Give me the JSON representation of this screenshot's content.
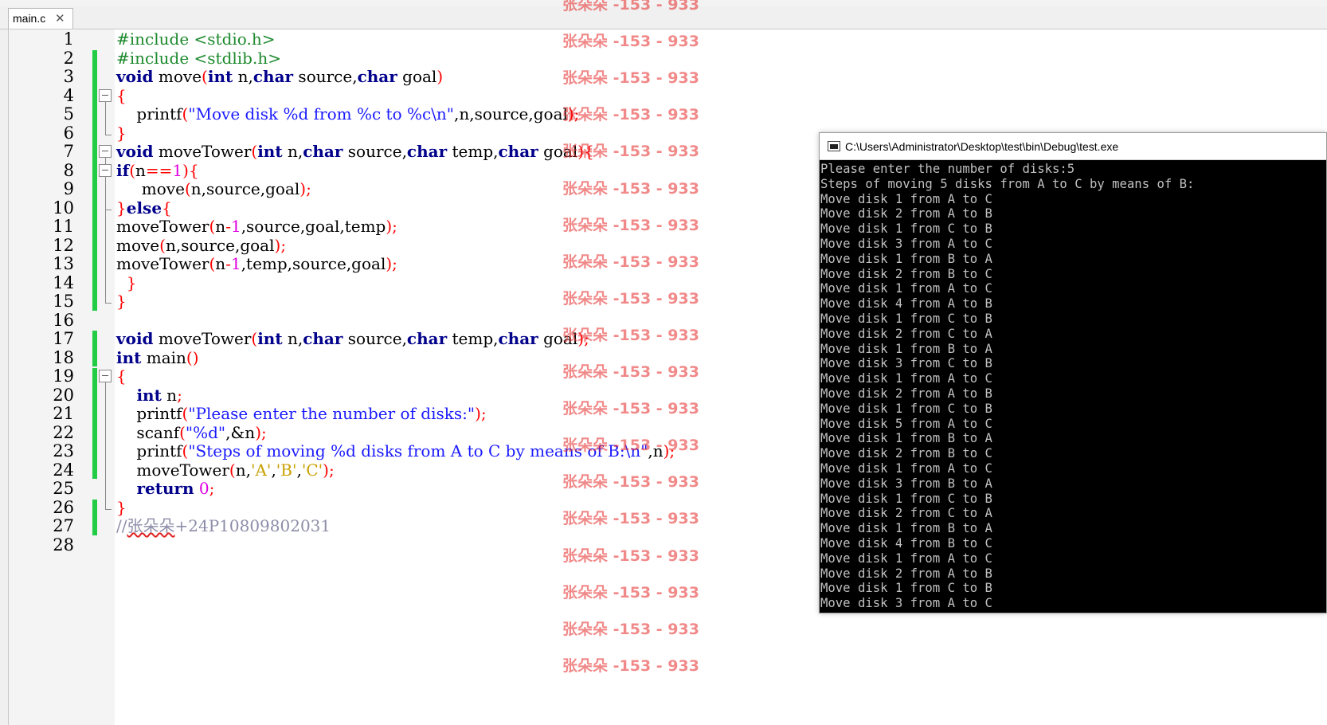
{
  "tab": {
    "label": "main.c",
    "close": "✕"
  },
  "line_numbers": [
    "1",
    "2",
    "3",
    "4",
    "5",
    "6",
    "7",
    "8",
    "9",
    "10",
    "11",
    "12",
    "13",
    "14",
    "15",
    "16",
    "17",
    "18",
    "19",
    "20",
    "21",
    "22",
    "23",
    "24",
    "25",
    "26",
    "27",
    "28"
  ],
  "code": {
    "line1": [
      "#include <stdio.h>"
    ],
    "line2": [
      "#include <stdlib.h>"
    ],
    "line3": [
      "void",
      " move",
      "(",
      "int",
      " n,",
      "char",
      " source,",
      "char",
      " goal",
      ")"
    ],
    "line4": [
      "{"
    ],
    "line5": [
      "    printf",
      "(",
      "\"Move disk %d from %c to %c\\n\"",
      ",n,source,goal",
      ")",
      ";"
    ],
    "line6": [
      "}"
    ],
    "line7": [
      "void",
      " moveTower",
      "(",
      "int",
      " n,",
      "char",
      " source,",
      "char",
      " temp,",
      "char",
      " goal",
      ")",
      "{"
    ],
    "line8": [
      "if",
      "(",
      "n",
      "==",
      "1",
      ")",
      "{"
    ],
    "line9": [
      "     move",
      "(",
      "n,source,goal",
      ")",
      ";"
    ],
    "line10": [
      "}",
      "else",
      "{"
    ],
    "line11": [
      "moveTower",
      "(",
      "n",
      "-",
      "1",
      ",source,goal,temp",
      ")",
      ";"
    ],
    "line12": [
      "move",
      "(",
      "n,source,goal",
      ")",
      ";"
    ],
    "line13": [
      "moveTower",
      "(",
      "n",
      "-",
      "1",
      ",temp,source,goal",
      ")",
      ";"
    ],
    "line14": [
      "  }"
    ],
    "line15": [
      "}"
    ],
    "line16": [
      ""
    ],
    "line17": [
      "void",
      " moveTower",
      "(",
      "int",
      " n,",
      "char",
      " source,",
      "char",
      " temp,",
      "char",
      " goal",
      ")",
      ";"
    ],
    "line18": [
      "int",
      " main",
      "()"
    ],
    "line19": [
      "{"
    ],
    "line20": [
      "    ",
      "int",
      " n",
      ";"
    ],
    "line21": [
      "    printf",
      "(",
      "\"Please enter the number of disks:\"",
      ")",
      ";"
    ],
    "line22": [
      "    scanf",
      "(",
      "\"%d\"",
      ",&n",
      ")",
      ";"
    ],
    "line23": [
      "    printf",
      "(",
      "\"Steps of moving %d disks from A to C by means of B:\\n\"",
      ",n",
      ")",
      ";"
    ],
    "line24": [
      "    moveTower",
      "(",
      "n,",
      "'A'",
      ",",
      "'B'",
      ",",
      "'C'",
      ")",
      ";"
    ],
    "line25": [
      "    ",
      "return",
      " ",
      "0",
      ";"
    ],
    "line26": [
      "}"
    ],
    "line27": [
      "//",
      "张朵朵",
      "+24P10809802031"
    ]
  },
  "watermark": {
    "text": "张朵朵 -153 - 933"
  },
  "console": {
    "title": "C:\\Users\\Administrator\\Desktop\\test\\bin\\Debug\\test.exe",
    "lines": [
      "Please enter the number of disks:5",
      "Steps of moving 5 disks from A to C by means of B:",
      "Move disk 1 from A to C",
      "Move disk 2 from A to B",
      "Move disk 1 from C to B",
      "Move disk 3 from A to C",
      "Move disk 1 from B to A",
      "Move disk 2 from B to C",
      "Move disk 1 from A to C",
      "Move disk 4 from A to B",
      "Move disk 1 from C to B",
      "Move disk 2 from C to A",
      "Move disk 1 from B to A",
      "Move disk 3 from C to B",
      "Move disk 1 from A to C",
      "Move disk 2 from A to B",
      "Move disk 1 from C to B",
      "Move disk 5 from A to C",
      "Move disk 1 from B to A",
      "Move disk 2 from B to C",
      "Move disk 1 from A to C",
      "Move disk 3 from B to A",
      "Move disk 1 from C to B",
      "Move disk 2 from C to A",
      "Move disk 1 from B to A",
      "Move disk 4 from B to C",
      "Move disk 1 from A to C",
      "Move disk 2 from A to B",
      "Move disk 1 from C to B",
      "Move disk 3 from A to C"
    ]
  },
  "colors": {
    "keyword": "#00008b",
    "preprocessor": "#1d8a2d",
    "string": "#1a1aff",
    "char_literal": "#c8a000",
    "number": "#e000e0",
    "operator": "#ff0000",
    "comment": "#8c8ca8",
    "change_bar": "#22cc44",
    "watermark": "#e62828"
  }
}
